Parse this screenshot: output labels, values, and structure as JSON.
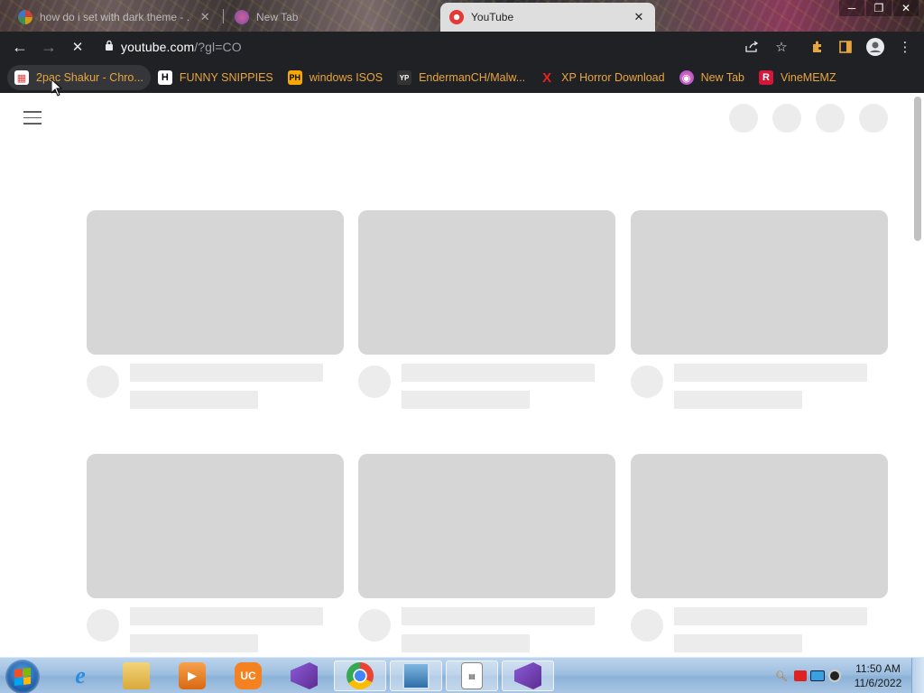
{
  "browser": {
    "tabs": [
      {
        "title": "how do i set with dark theme - ...",
        "active": false,
        "favicon": "google-icon"
      },
      {
        "title": "New Tab",
        "active": false,
        "favicon": "colorful-icon"
      },
      {
        "title": "YouTube",
        "active": true,
        "favicon": "youtube-icon"
      }
    ],
    "window_controls": {
      "minimize": "─",
      "maximize": "❐",
      "close": "✕"
    },
    "url_domain": "youtube.com",
    "url_rest": "/?gl=CO",
    "bookmarks": [
      {
        "label": "2pac Shakur - Chro...",
        "icon": "chrome-store-icon",
        "badge": "▦"
      },
      {
        "label": "FUNNY SNIPPIES",
        "icon": "h-icon",
        "badge": "H"
      },
      {
        "label": "windows ISOS",
        "icon": "ph-icon",
        "badge": "PH"
      },
      {
        "label": "EndermanCH/Malw...",
        "icon": "yp-icon",
        "badge": "YP"
      },
      {
        "label": "XP Horror Download",
        "icon": "x-icon",
        "badge": "X"
      },
      {
        "label": "New Tab",
        "icon": "colorful-icon",
        "badge": "◉"
      },
      {
        "label": "VineMEMZ",
        "icon": "r-icon",
        "badge": "R"
      }
    ]
  },
  "taskbar": {
    "time": "11:50 AM",
    "date": "11/6/2022",
    "apps": [
      {
        "name": "internet-explorer-icon",
        "open": false
      },
      {
        "name": "file-explorer-icon",
        "open": false
      },
      {
        "name": "media-player-icon",
        "open": false
      },
      {
        "name": "uc-browser-icon",
        "open": false
      },
      {
        "name": "visual-studio-icon",
        "open": false
      },
      {
        "name": "chrome-icon",
        "open": true
      },
      {
        "name": "photo-viewer-icon",
        "open": true
      },
      {
        "name": "notepad-icon",
        "open": true
      },
      {
        "name": "visual-studio-installer-icon",
        "open": true
      }
    ]
  },
  "colors": {
    "bookmark_text": "#e8a640",
    "placeholder_thumb": "#d6d6d6",
    "placeholder_line": "#ececec",
    "toolbar_bg": "#202124"
  }
}
